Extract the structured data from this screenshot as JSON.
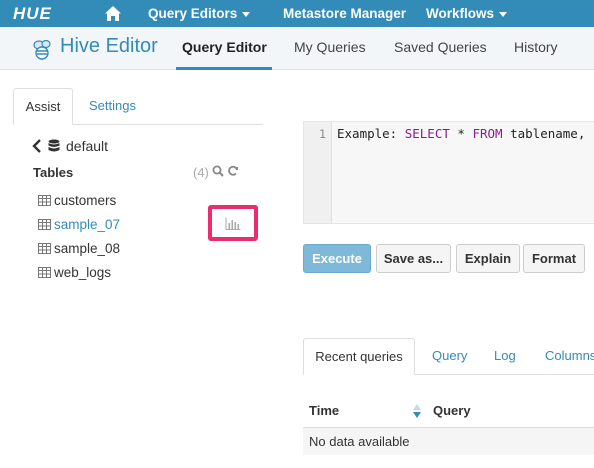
{
  "topnav": {
    "logo": "HUE",
    "items": [
      {
        "label": "Query Editors",
        "dropdown": true
      },
      {
        "label": "Metastore Manager",
        "dropdown": false
      },
      {
        "label": "Workflows",
        "dropdown": true
      }
    ]
  },
  "app": {
    "title": "Hive Editor",
    "tabs": [
      "Query Editor",
      "My Queries",
      "Saved Queries",
      "History"
    ],
    "active_tab": "Query Editor"
  },
  "assist": {
    "tabs": [
      "Assist",
      "Settings"
    ],
    "database": "default",
    "tables_label": "Tables",
    "tables_count": "(4)",
    "tables": [
      "customers",
      "sample_07",
      "sample_08",
      "web_logs"
    ],
    "hovered_table": "sample_07"
  },
  "editor": {
    "line_number": "1",
    "code": {
      "prefix": "Example: ",
      "kw1": "SELECT",
      "mid": " * ",
      "kw2": "FROM",
      "suffix": " tablename,"
    }
  },
  "buttons": {
    "execute": "Execute",
    "save_as": "Save as...",
    "explain": "Explain",
    "format": "Format"
  },
  "results": {
    "tabs": [
      "Recent queries",
      "Query",
      "Log",
      "Columns"
    ],
    "columns": [
      "Time",
      "Query"
    ],
    "empty": "No data available"
  },
  "colors": {
    "brand": "#338bb8",
    "highlight": "#ea2d6e"
  }
}
